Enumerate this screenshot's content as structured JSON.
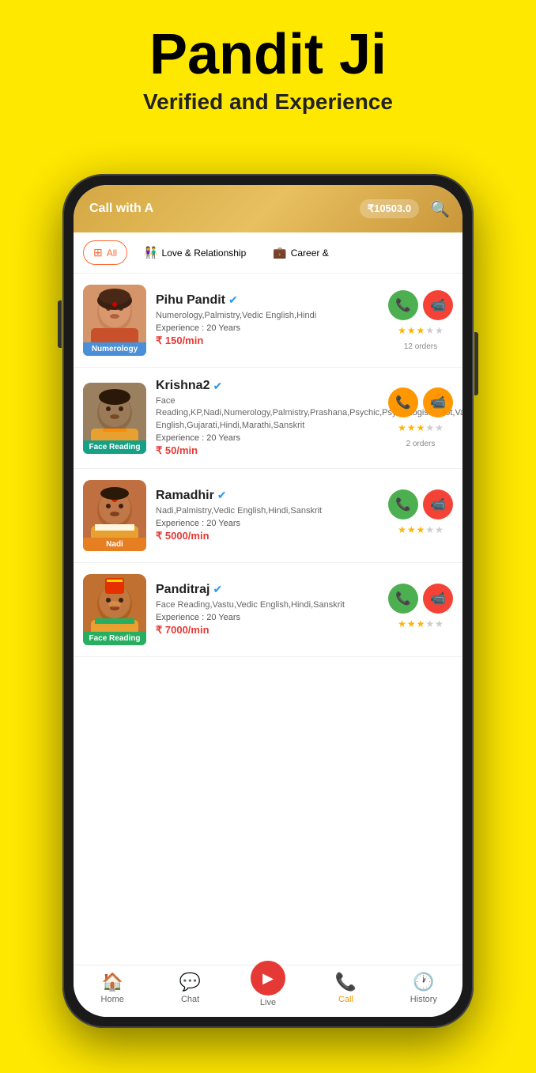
{
  "page": {
    "title": "Pandit Ji",
    "subtitle": "Verified and Experience"
  },
  "header": {
    "call_with": "Call with A",
    "balance": "₹10503.0",
    "search_placeholder": "Search"
  },
  "filters": [
    {
      "id": "all",
      "label": "All",
      "active": true,
      "icon": "⊞"
    },
    {
      "id": "love",
      "label": "Love & Relationship",
      "active": false,
      "icon": "👫"
    },
    {
      "id": "career",
      "label": "Career &",
      "active": false,
      "icon": "💼"
    }
  ],
  "astrologers": [
    {
      "id": "pihu",
      "name": "Pihu Pandit",
      "verified": true,
      "skills": "Numerology,Palmistry,Vedic English,Hindi",
      "experience": "Experience : 20 Years",
      "price": "₹ 150/min",
      "badge": "Numerology",
      "badge_color": "blue",
      "stars": 3,
      "orders": "12 orders",
      "call_available": true,
      "video_available": true,
      "call_color": "green",
      "video_color": "red"
    },
    {
      "id": "krishna",
      "name": "Krishna2",
      "verified": true,
      "skills": "Face Reading,KP,Nadi,Numerology,Palmistry,Prashana,Psychic,Psychologist,Tarot,Vastu,Vedic English,Gujarati,Hindi,Marathi,Sanskrit",
      "experience": "Experience : 20 Years",
      "price": "₹ 50/min",
      "badge": "Face Reading",
      "badge_color": "teal",
      "stars": 3,
      "orders": "2 orders",
      "call_available": true,
      "video_available": true,
      "call_color": "orange",
      "video_color": "orange"
    },
    {
      "id": "ramadhir",
      "name": "Ramadhir",
      "verified": true,
      "skills": "Nadi,Palmistry,Vedic English,Hindi,Sanskrit",
      "experience": "Experience : 20 Years",
      "price": "₹ 5000/min",
      "badge": "Nadi",
      "badge_color": "orange",
      "stars": 3,
      "orders": "",
      "call_available": true,
      "video_available": true,
      "call_color": "green",
      "video_color": "red"
    },
    {
      "id": "panditraj",
      "name": "Panditraj",
      "verified": true,
      "skills": "Face Reading,Vastu,Vedic English,Hindi,Sanskrit",
      "experience": "Experience : 20 Years",
      "price": "₹ 7000/min",
      "badge": "Face Reading",
      "badge_color": "green",
      "stars": 3,
      "orders": "",
      "call_available": true,
      "video_available": true,
      "call_color": "green",
      "video_color": "red"
    }
  ],
  "bottom_nav": [
    {
      "id": "home",
      "label": "Home",
      "icon": "🏠",
      "active": false
    },
    {
      "id": "chat",
      "label": "Chat",
      "icon": "💬",
      "active": false
    },
    {
      "id": "live",
      "label": "Live",
      "icon": "▶",
      "active": false,
      "special": true
    },
    {
      "id": "call",
      "label": "Call",
      "icon": "📞",
      "active": true
    },
    {
      "id": "history",
      "label": "History",
      "icon": "🕐",
      "active": false
    }
  ]
}
